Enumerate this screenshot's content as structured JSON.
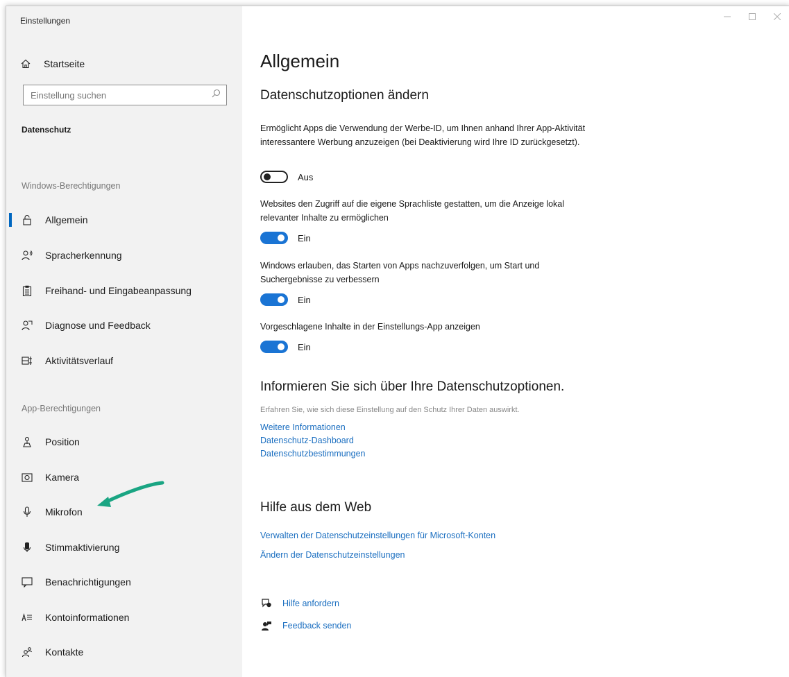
{
  "window": {
    "title": "Einstellungen"
  },
  "sidebar": {
    "home_label": "Startseite",
    "search_placeholder": "Einstellung suchen",
    "category": "Datenschutz",
    "group_windows": "Windows-Berechtigungen",
    "group_apps": "App-Berechtigungen",
    "items": [
      {
        "label": "Allgemein",
        "icon": "lock-icon",
        "active": true
      },
      {
        "label": "Spracherkennung",
        "icon": "speech-icon"
      },
      {
        "label": "Freihand- und Eingabeanpassung",
        "icon": "clipboard-icon"
      },
      {
        "label": "Diagnose und Feedback",
        "icon": "diagnostics-icon"
      },
      {
        "label": "Aktivitätsverlauf",
        "icon": "timeline-icon"
      },
      {
        "label": "Position",
        "icon": "location-icon"
      },
      {
        "label": "Kamera",
        "icon": "camera-icon"
      },
      {
        "label": "Mikrofon",
        "icon": "microphone-icon"
      },
      {
        "label": "Stimmaktivierung",
        "icon": "voice-activation-icon"
      },
      {
        "label": "Benachrichtigungen",
        "icon": "notifications-icon"
      },
      {
        "label": "Kontoinformationen",
        "icon": "account-info-icon"
      },
      {
        "label": "Kontakte",
        "icon": "contacts-icon"
      }
    ]
  },
  "main": {
    "title": "Allgemein",
    "section_title": "Datenschutzoptionen ändern",
    "options": [
      {
        "description": "Ermöglicht Apps die Verwendung der Werbe-ID, um Ihnen anhand Ihrer App-Aktivität interessantere Werbung anzuzeigen (bei Deaktivierung wird Ihre ID zurückgesetzt).",
        "state": "Aus",
        "on": false
      },
      {
        "description": "Websites den Zugriff auf die eigene Sprachliste gestatten, um die Anzeige lokal relevanter Inhalte zu ermöglichen",
        "state": "Ein",
        "on": true
      },
      {
        "description": "Windows erlauben, das Starten von Apps nachzuverfolgen, um Start und Suchergebnisse zu verbessern",
        "state": "Ein",
        "on": true
      },
      {
        "description": "Vorgeschlagene Inhalte in der Einstellungs-App anzeigen",
        "state": "Ein",
        "on": true
      }
    ],
    "info_title": "Informieren Sie sich über Ihre Datenschutzoptionen.",
    "info_text": "Erfahren Sie, wie sich diese Einstellung auf den Schutz Ihrer Daten auswirkt.",
    "info_links": [
      "Weitere Informationen",
      "Datenschutz-Dashboard",
      "Datenschutzbestimmungen"
    ],
    "web_title": "Hilfe aus dem Web",
    "web_links": [
      "Verwalten der Datenschutzeinstellungen für Microsoft-Konten",
      "Ändern der Datenschutzeinstellungen"
    ],
    "help_label": "Hilfe anfordern",
    "feedback_label": "Feedback senden"
  },
  "colors": {
    "accent": "#1a74d4",
    "link": "#1a6ec0",
    "annotation_arrow": "#1aa583"
  }
}
